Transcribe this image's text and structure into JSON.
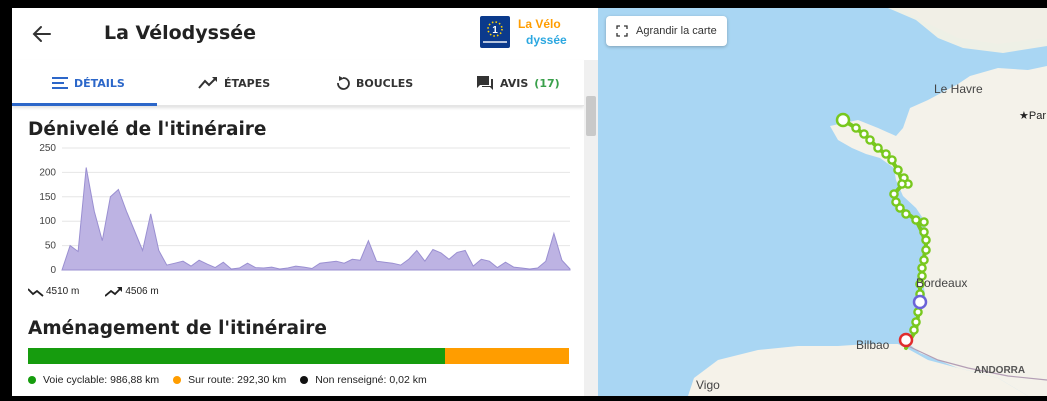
{
  "header": {
    "title": "La Vélodyssée",
    "logo_badge": "1",
    "logo_text_1": "La Vélo",
    "logo_text_2": "dyssée"
  },
  "tabs": [
    {
      "label": "DÉTAILS"
    },
    {
      "label": "ÉTAPES"
    },
    {
      "label": "BOUCLES"
    },
    {
      "label": "AVIS",
      "count": "(17)"
    }
  ],
  "elevation": {
    "title": "Dénivelé de l'itinéraire",
    "descent": "4510 m",
    "ascent": "4506 m"
  },
  "chart_data": {
    "type": "area",
    "y_ticks": [
      "250",
      "200",
      "150",
      "100",
      "50",
      "0"
    ],
    "ylim": [
      0,
      250
    ],
    "values": [
      0,
      50,
      38,
      210,
      120,
      60,
      150,
      165,
      120,
      80,
      40,
      115,
      40,
      10,
      14,
      18,
      8,
      20,
      12,
      5,
      16,
      2,
      4,
      14,
      5,
      4,
      6,
      2,
      4,
      8,
      6,
      3,
      14,
      16,
      18,
      14,
      22,
      20,
      60,
      18,
      16,
      14,
      10,
      22,
      40,
      18,
      42,
      35,
      22,
      36,
      40,
      8,
      22,
      18,
      5,
      16,
      6,
      4,
      2,
      4,
      18,
      75,
      20,
      2
    ],
    "fill_color": "#bdb3e3",
    "line_color": "#9a8fd1"
  },
  "amenagement": {
    "title": "Aménagement de l'itinéraire",
    "segments": [
      {
        "label": "Voie cyclable: 986,88 km",
        "value": 986.88,
        "color": "#169c0e"
      },
      {
        "label": "Sur route: 292,30 km",
        "value": 292.3,
        "color": "#ff9d00"
      },
      {
        "label": "Non renseigné: 0,02 km",
        "value": 0.02,
        "color": "#111111"
      }
    ]
  },
  "map": {
    "expand_label": "Agrandir la carte",
    "labels": {
      "le_havre": "Le Havre",
      "paris": "★Par",
      "bordeaux": "Bordeaux",
      "bilbao": "Bilbao",
      "andorra": "ANDORRA",
      "vigo": "Vigo"
    },
    "route_color": "#78c81e"
  }
}
